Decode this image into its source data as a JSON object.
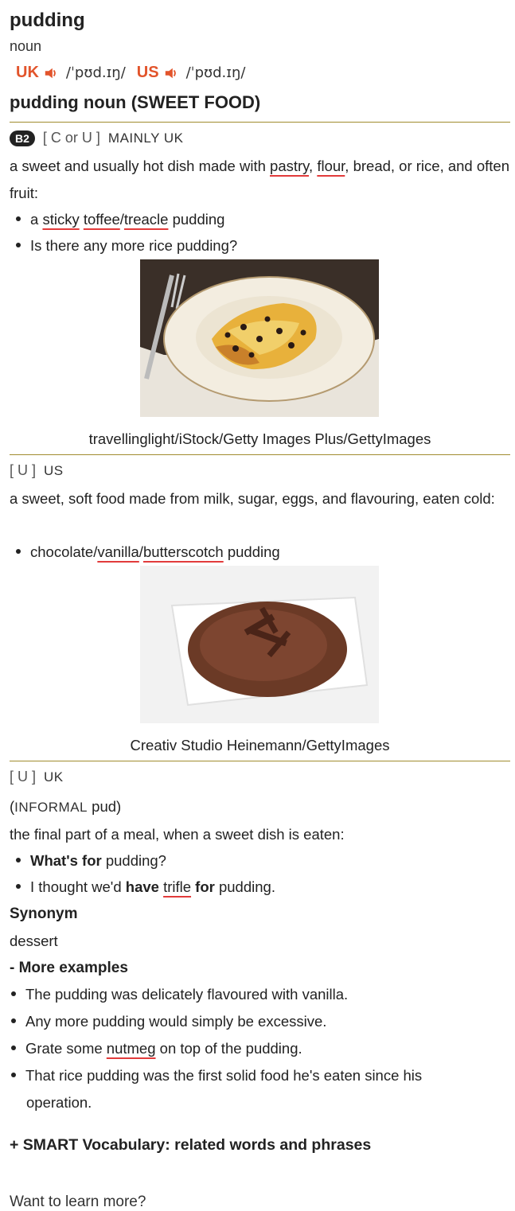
{
  "entry": {
    "headword": "pudding",
    "pos": "noun",
    "uk_label": "UK",
    "uk_ipa": "/ˈpʊd.ɪŋ/",
    "us_label": "US",
    "us_ipa": "/ˈpʊd.ɪŋ/",
    "sense_title": "pudding noun (SWEET FOOD)"
  },
  "sense1": {
    "level": "B2",
    "grammar": "[ C or U ]",
    "usage": "MAINLY UK",
    "def_a": "a sweet and usually hot dish made with ",
    "def_w1": "pastry",
    "def_b": ", ",
    "def_w2": "flour",
    "def_c": ", bread, or rice, and often fruit:",
    "ex1_a": "a ",
    "ex1_w1": "sticky",
    "ex1_sp": " ",
    "ex1_w2": "toffee",
    "ex1_slash": "/",
    "ex1_w3": "treacle",
    "ex1_b": " pudding",
    "ex2": "Is there any more rice pudding?",
    "caption": "travellinglight/iStock/Getty Images Plus/GettyImages"
  },
  "sense2": {
    "grammar": "[ U ]",
    "usage": "US",
    "def": "a sweet, soft food made from milk, sugar, eggs, and flavouring, eaten cold:",
    "ex1_a": "chocolate/",
    "ex1_w1": "vanilla",
    "ex1_slash": "/",
    "ex1_w2": "butterscotch",
    "ex1_b": " pudding",
    "caption": "Creativ Studio Heinemann/GettyImages"
  },
  "sense3": {
    "grammar": "[ U ]",
    "usage": "UK",
    "informal_open": "(",
    "informal_label": "INFORMAL",
    "informal_word": " pud)",
    "def": "the final part of a meal, when a sweet dish is eaten:",
    "ex1_bold": "What's for",
    "ex1_rest": " pudding?",
    "ex2_a": "I thought we'd ",
    "ex2_bold1": "have",
    "ex2_sp": " ",
    "ex2_w": "trifle",
    "ex2_sp2": " ",
    "ex2_bold2": "for",
    "ex2_b": " pudding.",
    "synonym_label": "Synonym",
    "synonym": "dessert"
  },
  "more_examples": {
    "label": "- More examples",
    "items": [
      "The pudding was delicately flavoured with vanilla.",
      "Any more pudding would simply be excessive.",
      "Grate some ",
      "That rice pudding was the first solid food he's eaten since his operation."
    ],
    "item3_word": "nutmeg",
    "item3_rest": " on top of the pudding."
  },
  "smart_vocab": "+ SMART Vocabulary: related words and phrases",
  "cutoff_text": "Want to learn more?"
}
